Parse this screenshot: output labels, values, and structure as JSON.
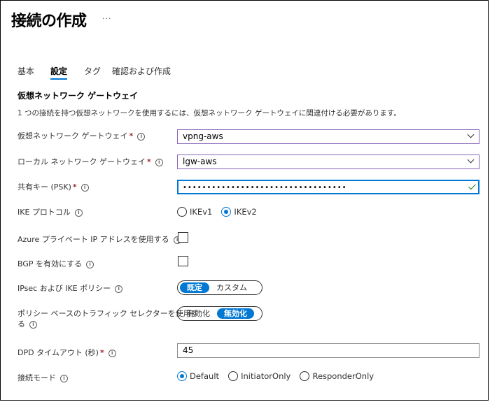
{
  "header": {
    "title": "接続の作成",
    "more": "···"
  },
  "tabs": [
    {
      "label": "基本"
    },
    {
      "label": "設定"
    },
    {
      "label": "タグ"
    },
    {
      "label": "確認および作成"
    }
  ],
  "section": {
    "title": "仮想ネットワーク ゲートウェイ",
    "description": "1 つの接続を持つ仮想ネットワークを使用するには、仮想ネットワーク ゲートウェイに関連付ける必要があります。"
  },
  "form": {
    "vng": {
      "label": "仮想ネットワーク ゲートウェイ",
      "value": "vpng-aws"
    },
    "lng": {
      "label": "ローカル ネットワーク ゲートウェイ",
      "value": "lgw-aws"
    },
    "psk": {
      "label": "共有キー (PSK)",
      "value": "••••••••••••••••••••••••••••••••••"
    },
    "ike": {
      "label": "IKE プロトコル",
      "options": [
        "IKEv1",
        "IKEv2"
      ],
      "selected": "IKEv2"
    },
    "azure_private_ip": {
      "label": "Azure プライベート IP アドレスを使用する",
      "checked": false
    },
    "bgp": {
      "label": "BGP を有効にする",
      "checked": false
    },
    "ipsec": {
      "label": "IPsec および IKE ポリシー",
      "options": [
        "既定",
        "カスタム"
      ],
      "selected": "既定"
    },
    "policy_selector": {
      "label_line1": "ポリシー ベースのトラフィック セレクターを使用す",
      "label_line2": "る",
      "options": [
        "有効化",
        "無効化"
      ],
      "selected": "無効化"
    },
    "dpd": {
      "label": "DPD タイムアウト (秒)",
      "value": "45"
    },
    "mode": {
      "label": "接続モード",
      "options": [
        "Default",
        "InitiatorOnly",
        "ResponderOnly"
      ],
      "selected": "Default"
    }
  },
  "symbols": {
    "required": "*",
    "info": "i"
  },
  "colors": {
    "accent": "#0078d4",
    "required": "#a4262c",
    "valid": "#107c10",
    "dropdown_border": "#8764b8"
  }
}
